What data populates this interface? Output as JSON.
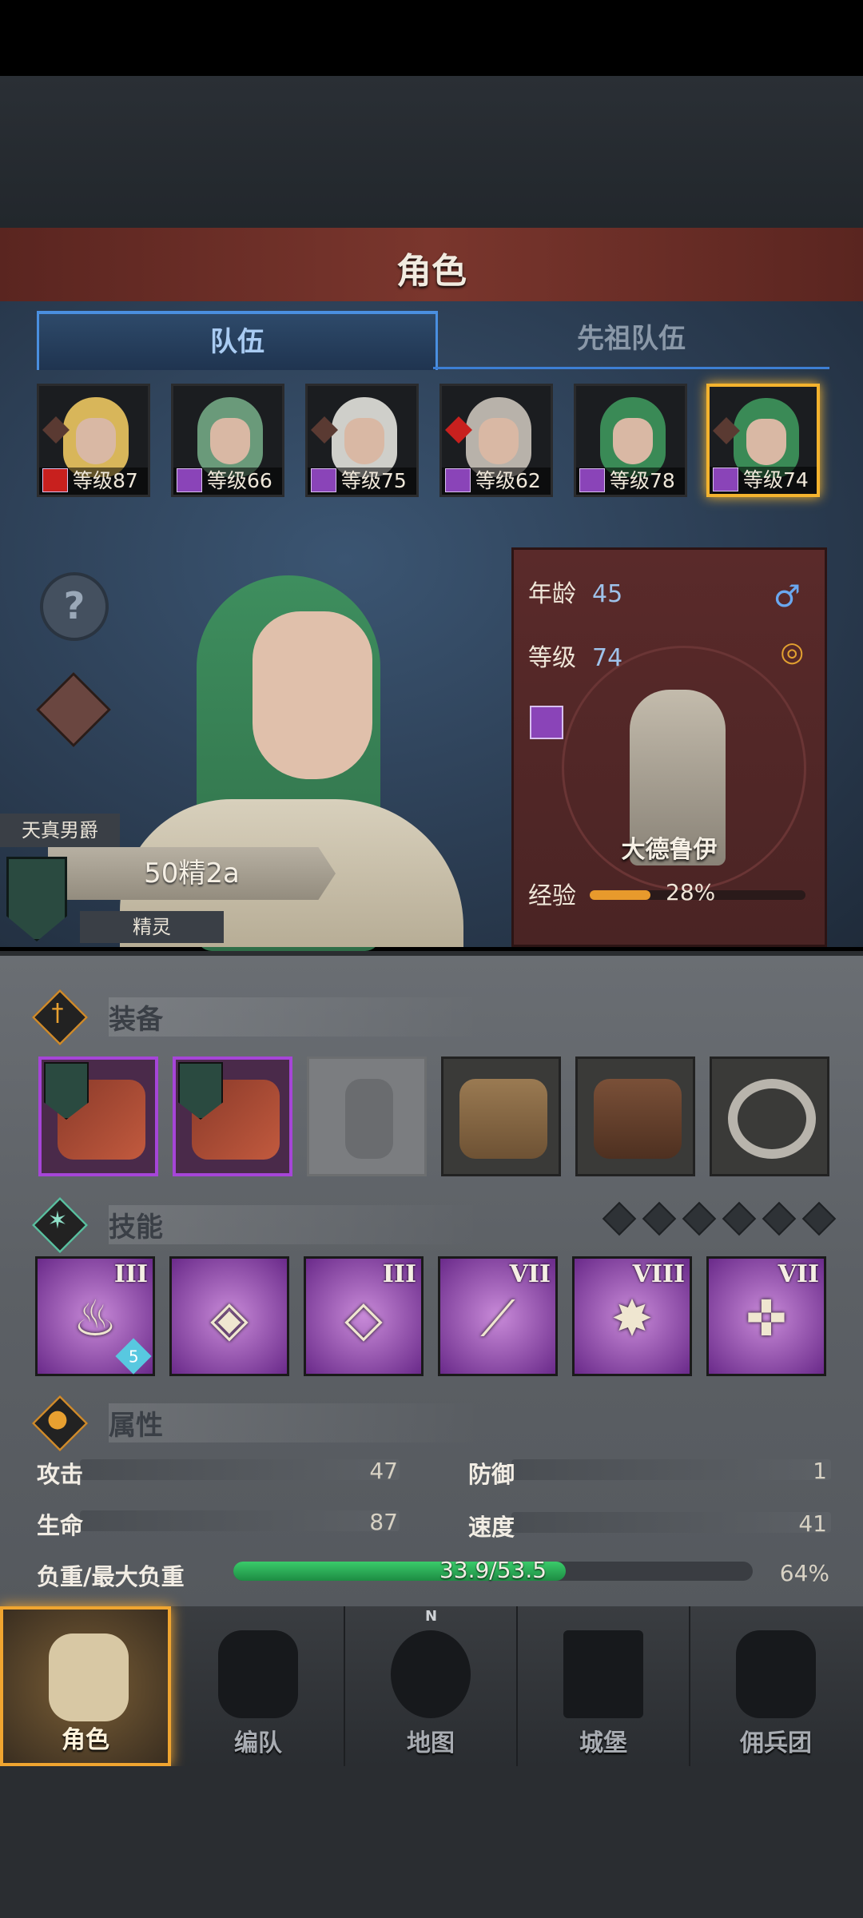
{
  "title": "角色",
  "tabs": [
    {
      "label": "队伍",
      "active": true
    },
    {
      "label": "先祖队伍",
      "active": false
    }
  ],
  "heroes": [
    {
      "level_label": "等级87",
      "hair": "#d8b65a",
      "class_icon": "house-icon",
      "trait_icon": "knight-icon",
      "selected": false
    },
    {
      "level_label": "等级66",
      "hair": "#6a9a7a",
      "class_icon": "staff-icon",
      "trait_icon": "",
      "selected": false
    },
    {
      "level_label": "等级75",
      "hair": "#cfcfca",
      "class_icon": "staff-icon",
      "trait_icon": "knight-icon",
      "selected": false
    },
    {
      "level_label": "等级62",
      "hair": "#b8b2aa",
      "class_icon": "staff-icon",
      "trait_icon": "red-knight-icon",
      "selected": false
    },
    {
      "level_label": "等级78",
      "hair": "#3a8a56",
      "class_icon": "staff-icon",
      "trait_icon": "",
      "selected": false
    },
    {
      "level_label": "等级74",
      "hair": "#3a8a56",
      "class_icon": "staff-icon",
      "trait_icon": "knight-icon",
      "selected": true
    }
  ],
  "character": {
    "title": "天真男爵",
    "name": "50精2a",
    "race": "精灵",
    "age_label": "年龄",
    "age": "45",
    "level_label": "等级",
    "level": "74",
    "class_name": "大德鲁伊",
    "exp_label": "经验",
    "exp_percent": "28%",
    "exp_value": 0.28,
    "gender_icon": "male-icon",
    "married_icon": "rings-icon"
  },
  "sections": {
    "equipment": "装备",
    "skills": "技能",
    "attributes": "属性"
  },
  "equipment": [
    {
      "name": "feather-weapon-1",
      "type": "weapon"
    },
    {
      "name": "feather-weapon-2",
      "type": "weapon"
    },
    {
      "name": "helmet-empty",
      "type": "empty"
    },
    {
      "name": "shirt",
      "type": "armor"
    },
    {
      "name": "boots",
      "type": "armor"
    },
    {
      "name": "ring",
      "type": "armor"
    }
  ],
  "skills": [
    {
      "icon": "flame-icon",
      "rank": "III",
      "badge": "5"
    },
    {
      "icon": "tornado-icon",
      "rank": "",
      "badge": ""
    },
    {
      "icon": "crystal-arm-icon",
      "rank": "III",
      "badge": ""
    },
    {
      "icon": "spear-icon",
      "rank": "VII",
      "badge": ""
    },
    {
      "icon": "burst-icon",
      "rank": "VIII",
      "badge": ""
    },
    {
      "icon": "holy-cross-icon",
      "rank": "VII",
      "badge": ""
    }
  ],
  "skill_points_total": 6,
  "attributes": {
    "attack_label": "攻击",
    "attack": "47",
    "defense_label": "防御",
    "defense": "1",
    "hp_label": "生命",
    "hp": "87",
    "speed_label": "速度",
    "speed": "41",
    "load_label": "负重/最大负重",
    "load": "33.9/53.5",
    "load_percent": "64%",
    "load_value": 0.64
  },
  "nav": [
    {
      "label": "角色",
      "icon": "knight-icon",
      "active": true
    },
    {
      "label": "编队",
      "icon": "helmet-icon",
      "active": false
    },
    {
      "label": "地图",
      "icon": "compass-icon",
      "active": false
    },
    {
      "label": "城堡",
      "icon": "castle-icon",
      "active": false
    },
    {
      "label": "佣兵团",
      "icon": "mercenary-icon",
      "active": false
    }
  ],
  "colors": {
    "accent_gold": "#f4b32e",
    "tab_blue": "#4a8fe0",
    "class_purple": "#8a44b8",
    "load_green": "#2fae58"
  }
}
